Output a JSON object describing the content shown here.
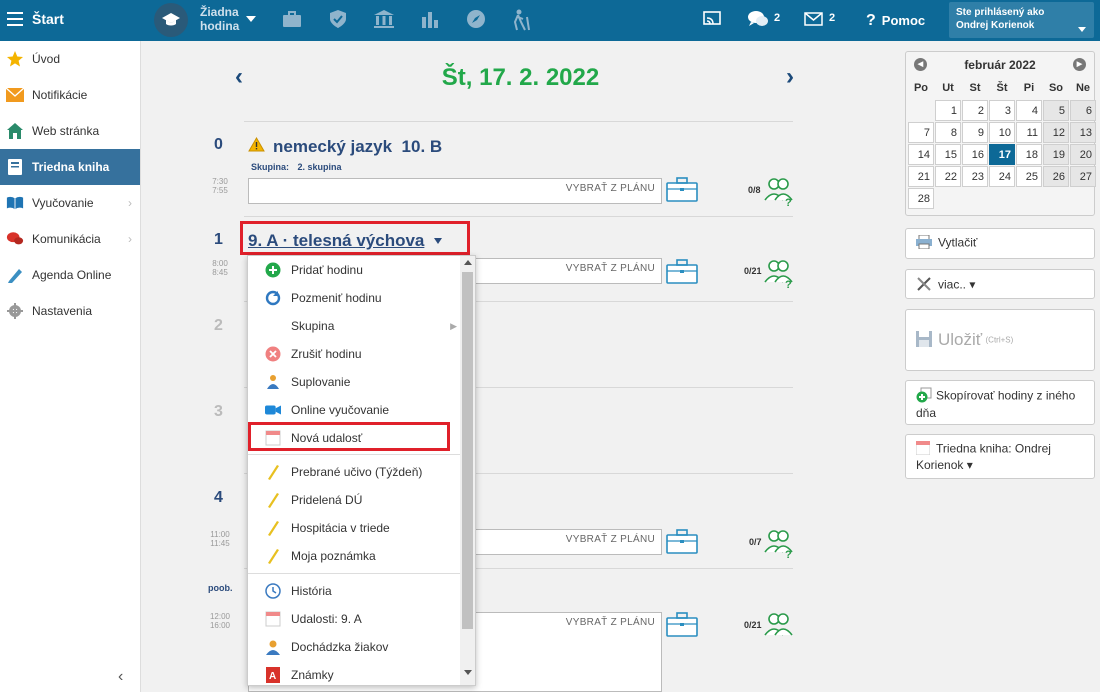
{
  "topbar": {
    "start_label": "Štart",
    "hour_label": [
      "Žiadna",
      "hodina"
    ],
    "messages_count": "2",
    "mail_count": "2",
    "help_label": "Pomoc",
    "logged_in_label": "Ste prihlásený ako",
    "user_name": "Ondrej Korienok"
  },
  "sidebar": {
    "items": [
      {
        "label": "Úvod",
        "icon": "star-icon"
      },
      {
        "label": "Notifikácie",
        "icon": "envelope-icon"
      },
      {
        "label": "Web stránka",
        "icon": "home-icon"
      },
      {
        "label": "Triedna kniha",
        "icon": "book-icon"
      },
      {
        "label": "Vyučovanie",
        "icon": "open-book-icon"
      },
      {
        "label": "Komunikácia",
        "icon": "chat-icon"
      },
      {
        "label": "Agenda Online",
        "icon": "pen-icon"
      },
      {
        "label": "Nastavenia",
        "icon": "gear-icon"
      }
    ]
  },
  "main": {
    "date_title": "Št, 17. 2. 2022",
    "plan_placeholder": "VYBRAŤ Z PLÁNU",
    "period0": {
      "num": "0",
      "subject": "nemecký jazyk  10. B",
      "group_label": "Skupina:",
      "group_value": "2. skupina",
      "time_start": "7:30",
      "time_end": "7:55",
      "attendance": "0/8"
    },
    "period1": {
      "num": "1",
      "subject": "9. A · telesná výchova",
      "time_start": "8:00",
      "time_end": "8:45",
      "attendance": "0/21"
    },
    "period2_num": "2",
    "period3_num": "3",
    "period4": {
      "num": "4",
      "time_start": "11:00",
      "time_end": "11:45",
      "attendance": "0/7"
    },
    "afternoon": {
      "label": "poob.",
      "time_start": "12:00",
      "time_end": "16:00",
      "attendance": "0/21"
    }
  },
  "context_menu": {
    "items": [
      "Pridať hodinu",
      "Pozmeniť hodinu",
      "Skupina",
      "Zrušiť hodinu",
      "Suplovanie",
      "Online vyučovanie",
      "Nová udalosť",
      "Prebrané učivo (Týždeň)",
      "Pridelená DÚ",
      "Hospitácia v triede",
      "Moja poznámka",
      "História",
      "Udalosti: 9. A",
      "Dochádzka žiakov",
      "Známky"
    ]
  },
  "calendar": {
    "month": "február 2022",
    "weekdays": [
      "Po",
      "Ut",
      "St",
      "Št",
      "Pi",
      "So",
      "Ne"
    ],
    "today": "17"
  },
  "right_actions": {
    "print": "Vytlačiť",
    "more": "viac.. ▾",
    "save": "Uložiť",
    "save_shortcut": "(Ctrl+S)",
    "copy": "Skopírovať hodiny z iného dňa",
    "classbook": "Triedna kniha: Ondrej Korienok ▾"
  },
  "colors": {
    "topbar": "#0d6997",
    "accent_green": "#22a84a",
    "subject_blue": "#2b4b7c",
    "highlight_red": "#e0202a"
  }
}
